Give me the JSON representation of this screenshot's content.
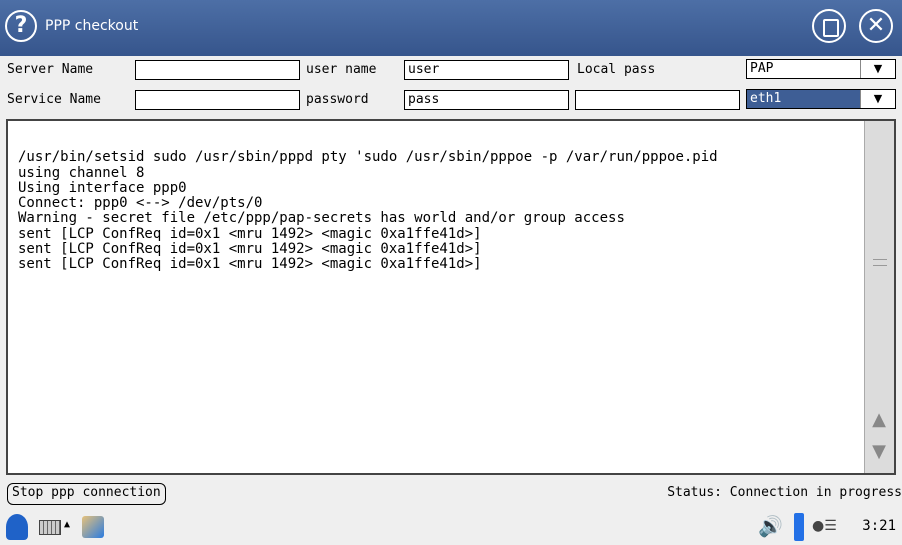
{
  "window": {
    "title": "PPP checkout"
  },
  "form": {
    "server_name_label": "Server Name",
    "server_name_value": "",
    "user_name_label": "user name",
    "user_name_value": "user",
    "local_pass_label": "Local pass",
    "local_pass_value": "",
    "auth_selected": "PAP",
    "service_name_label": "Service Name",
    "service_name_value": "",
    "password_label": "password",
    "password_value": "pass",
    "extra_field_value": "",
    "interface_selected": "eth1"
  },
  "output": {
    "lines": [
      "/usr/bin/setsid sudo /usr/sbin/pppd pty 'sudo /usr/sbin/pppoe -p /var/run/pppoe.pid",
      "using channel 8",
      "Using interface ppp0",
      "Connect: ppp0 <--> /dev/pts/0",
      "Warning - secret file /etc/ppp/pap-secrets has world and/or group access",
      "sent [LCP ConfReq id=0x1 <mru 1492> <magic 0xa1ffe41d>]",
      "sent [LCP ConfReq id=0x1 <mru 1492> <magic 0xa1ffe41d>]",
      "sent [LCP ConfReq id=0x1 <mru 1492> <magic 0xa1ffe41d>]"
    ]
  },
  "footer": {
    "stop_button": "Stop ppp connection",
    "status": "Status: Connection in progress"
  },
  "taskbar": {
    "clock": "3:21"
  },
  "icons": {
    "help": "help-icon",
    "maximize": "maximize-icon",
    "close": "close-icon",
    "start": "start-menu-icon",
    "keyboard": "keyboard-icon",
    "notes": "notes-icon",
    "volume": "volume-icon",
    "battery": "battery-icon",
    "network": "network-icon"
  },
  "colors": {
    "titlebar": "#3e5e95",
    "selection": "#3e5e95"
  }
}
